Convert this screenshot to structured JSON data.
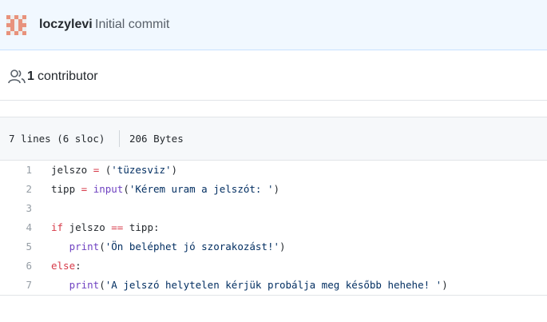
{
  "commit": {
    "author": "loczylevi",
    "message": "Initial commit",
    "avatar_colors": [
      "#e8927c",
      "#eeeeee"
    ]
  },
  "contributors": {
    "icon": "people-icon",
    "count": "1",
    "label": "contributor"
  },
  "file_info": {
    "lines": "7 lines (6 sloc)",
    "size": "206 Bytes"
  },
  "code": {
    "lines": [
      {
        "num": "1",
        "tokens": [
          {
            "t": "jelszo "
          },
          {
            "t": "=",
            "c": "kw"
          },
          {
            "t": " ("
          },
          {
            "t": "'tüzesviz'",
            "c": "st"
          },
          {
            "t": ")"
          }
        ]
      },
      {
        "num": "2",
        "tokens": [
          {
            "t": "tipp "
          },
          {
            "t": "=",
            "c": "kw"
          },
          {
            "t": " "
          },
          {
            "t": "input",
            "c": "fn"
          },
          {
            "t": "("
          },
          {
            "t": "'Kérem uram a jelszót: '",
            "c": "st"
          },
          {
            "t": ")"
          }
        ]
      },
      {
        "num": "3",
        "tokens": []
      },
      {
        "num": "4",
        "tokens": [
          {
            "t": "if",
            "c": "kw"
          },
          {
            "t": " jelszo "
          },
          {
            "t": "==",
            "c": "kw"
          },
          {
            "t": " tipp:"
          }
        ]
      },
      {
        "num": "5",
        "tokens": [
          {
            "t": "   "
          },
          {
            "t": "print",
            "c": "fn"
          },
          {
            "t": "("
          },
          {
            "t": "'Ön beléphet jó szorakozást!'",
            "c": "st"
          },
          {
            "t": ")"
          }
        ]
      },
      {
        "num": "6",
        "tokens": [
          {
            "t": "else",
            "c": "kw"
          },
          {
            "t": ":"
          }
        ]
      },
      {
        "num": "7",
        "tokens": [
          {
            "t": "   "
          },
          {
            "t": "print",
            "c": "fn"
          },
          {
            "t": "("
          },
          {
            "t": "'A jelszó helytelen kérjük probálja meg később hehehe! '",
            "c": "st"
          },
          {
            "t": ")"
          }
        ]
      }
    ]
  }
}
